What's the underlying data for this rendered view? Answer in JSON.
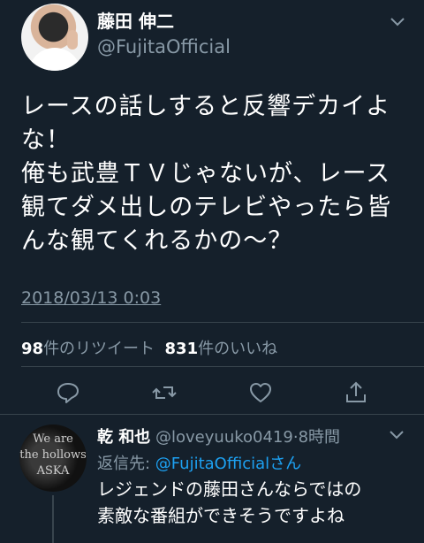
{
  "tweet": {
    "display_name": "藤田 伸二",
    "handle": "@FujitaOfficial",
    "text": "レースの話しすると反響デカイよな！\n俺も武豊ＴＶじゃないが、レース観てダメ出しのテレビやったら皆んな観てくれるかの〜？",
    "timestamp": "2018/03/13 0:03",
    "retweet_count": "98",
    "retweet_label": "件のリツイート",
    "like_count": "831",
    "like_label": "件のいいね"
  },
  "actions": {
    "reply": "reply-icon",
    "retweet": "retweet-icon",
    "like": "heart-icon",
    "share": "share-icon"
  },
  "reply": {
    "display_name": "乾 和也",
    "handle": "@loveyuuko0419",
    "separator": "·",
    "time": "8時間",
    "reply_label": "返信先: ",
    "reply_to": "@FujitaOfficialさん",
    "text": "レジェンドの藤田さんならではの\n素敵な番組ができそうですよね",
    "avatar_text": "We are\nthe hollows\nASKA"
  },
  "colors": {
    "background": "#15202b",
    "secondary_text": "#8899a6",
    "link": "#1da1f2",
    "divider": "#38444d"
  }
}
